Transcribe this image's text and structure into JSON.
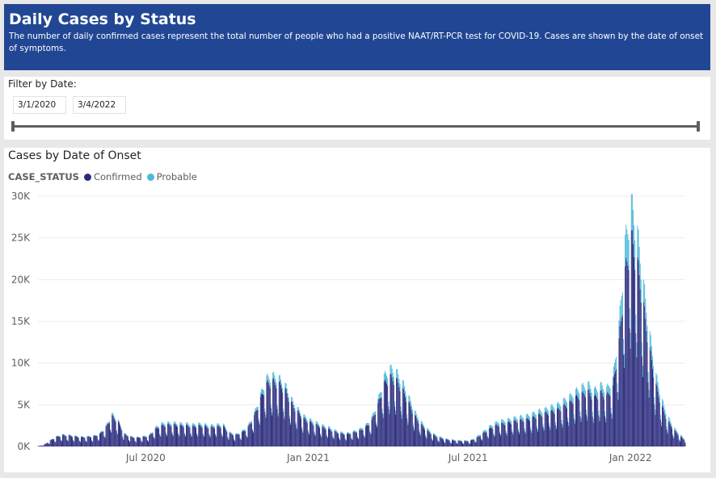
{
  "header": {
    "title": "Daily Cases by Status",
    "description": "The number of daily confirmed cases represent the total number of people who had a positive NAAT/RT-PCR test for COVID-19. Cases are shown by the date of onset of symptoms."
  },
  "filter": {
    "title": "Filter by Date:",
    "start_date": "3/1/2020",
    "end_date": "3/4/2022"
  },
  "chart_data": {
    "type": "bar",
    "title": "Cases by Date of Onset",
    "legend_title": "CASE_STATUS",
    "legend_position": "top-left",
    "grid": true,
    "stacked": true,
    "ylim": [
      0,
      30000
    ],
    "y_ticks": [
      "0K",
      "5K",
      "10K",
      "15K",
      "20K",
      "25K",
      "30K"
    ],
    "x_ticks": [
      "Jul 2020",
      "Jan 2021",
      "Jul 2021",
      "Jan 2022"
    ],
    "x_range": [
      "2020-03-01",
      "2022-03-04"
    ],
    "granularity": "daily (estimated weekly average values shown)",
    "series": [
      {
        "name": "Confirmed",
        "color": "#2a2a7c"
      },
      {
        "name": "Probable",
        "color": "#4fb9d8"
      }
    ],
    "points": [
      [
        "2020-03-01",
        50,
        0
      ],
      [
        "2020-03-08",
        200,
        10
      ],
      [
        "2020-03-15",
        700,
        30
      ],
      [
        "2020-03-22",
        1100,
        60
      ],
      [
        "2020-03-29",
        1300,
        80
      ],
      [
        "2020-04-05",
        1250,
        80
      ],
      [
        "2020-04-12",
        1150,
        80
      ],
      [
        "2020-04-19",
        1050,
        80
      ],
      [
        "2020-04-26",
        1100,
        80
      ],
      [
        "2020-05-03",
        1150,
        90
      ],
      [
        "2020-05-10",
        1400,
        100
      ],
      [
        "2020-05-17",
        2200,
        150
      ],
      [
        "2020-05-24",
        3500,
        250
      ],
      [
        "2020-05-31",
        2800,
        200
      ],
      [
        "2020-06-07",
        1400,
        100
      ],
      [
        "2020-06-14",
        1100,
        80
      ],
      [
        "2020-06-21",
        1000,
        70
      ],
      [
        "2020-06-28",
        1100,
        80
      ],
      [
        "2020-07-05",
        1200,
        90
      ],
      [
        "2020-07-12",
        2000,
        200
      ],
      [
        "2020-07-19",
        2400,
        250
      ],
      [
        "2020-07-26",
        2500,
        250
      ],
      [
        "2020-08-02",
        2500,
        250
      ],
      [
        "2020-08-09",
        2400,
        250
      ],
      [
        "2020-08-16",
        2400,
        250
      ],
      [
        "2020-08-23",
        2300,
        250
      ],
      [
        "2020-08-30",
        2400,
        250
      ],
      [
        "2020-09-06",
        2300,
        250
      ],
      [
        "2020-09-13",
        2200,
        250
      ],
      [
        "2020-09-20",
        2300,
        250
      ],
      [
        "2020-09-27",
        2300,
        250
      ],
      [
        "2020-10-04",
        1500,
        150
      ],
      [
        "2020-10-11",
        1300,
        120
      ],
      [
        "2020-10-18",
        1600,
        150
      ],
      [
        "2020-10-25",
        2200,
        200
      ],
      [
        "2020-11-01",
        3500,
        300
      ],
      [
        "2020-11-08",
        5500,
        500
      ],
      [
        "2020-11-15",
        7200,
        700
      ],
      [
        "2020-11-22",
        7500,
        700
      ],
      [
        "2020-11-29",
        7200,
        700
      ],
      [
        "2020-12-06",
        6500,
        600
      ],
      [
        "2020-12-13",
        5000,
        500
      ],
      [
        "2020-12-20",
        4000,
        400
      ],
      [
        "2020-12-27",
        3200,
        350
      ],
      [
        "2021-01-03",
        2800,
        300
      ],
      [
        "2021-01-10",
        2500,
        300
      ],
      [
        "2021-01-17",
        2200,
        250
      ],
      [
        "2021-01-24",
        2000,
        250
      ],
      [
        "2021-01-31",
        1700,
        200
      ],
      [
        "2021-02-07",
        1500,
        150
      ],
      [
        "2021-02-14",
        1400,
        150
      ],
      [
        "2021-02-21",
        1600,
        150
      ],
      [
        "2021-02-28",
        1800,
        200
      ],
      [
        "2021-03-07",
        2200,
        250
      ],
      [
        "2021-03-14",
        3000,
        300
      ],
      [
        "2021-03-21",
        4800,
        500
      ],
      [
        "2021-03-28",
        7200,
        900
      ],
      [
        "2021-04-04",
        8000,
        1000
      ],
      [
        "2021-04-11",
        7600,
        1000
      ],
      [
        "2021-04-18",
        6500,
        900
      ],
      [
        "2021-04-25",
        5000,
        700
      ],
      [
        "2021-05-02",
        3500,
        500
      ],
      [
        "2021-05-09",
        2500,
        350
      ],
      [
        "2021-05-16",
        1800,
        250
      ],
      [
        "2021-05-23",
        1300,
        180
      ],
      [
        "2021-05-30",
        1000,
        140
      ],
      [
        "2021-06-06",
        800,
        110
      ],
      [
        "2021-06-13",
        700,
        100
      ],
      [
        "2021-06-20",
        650,
        90
      ],
      [
        "2021-06-27",
        600,
        90
      ],
      [
        "2021-07-04",
        650,
        90
      ],
      [
        "2021-07-11",
        1000,
        150
      ],
      [
        "2021-07-18",
        1500,
        200
      ],
      [
        "2021-07-25",
        2000,
        300
      ],
      [
        "2021-08-01",
        2400,
        350
      ],
      [
        "2021-08-08",
        2600,
        400
      ],
      [
        "2021-08-15",
        2700,
        400
      ],
      [
        "2021-08-22",
        2900,
        400
      ],
      [
        "2021-08-29",
        3000,
        450
      ],
      [
        "2021-09-05",
        3100,
        450
      ],
      [
        "2021-09-12",
        3300,
        500
      ],
      [
        "2021-09-19",
        3600,
        500
      ],
      [
        "2021-09-26",
        3800,
        500
      ],
      [
        "2021-10-03",
        4000,
        600
      ],
      [
        "2021-10-10",
        4200,
        600
      ],
      [
        "2021-10-17",
        4600,
        700
      ],
      [
        "2021-10-24",
        5000,
        750
      ],
      [
        "2021-10-31",
        5600,
        800
      ],
      [
        "2021-11-07",
        6000,
        900
      ],
      [
        "2021-11-14",
        6300,
        900
      ],
      [
        "2021-11-21",
        5600,
        900
      ],
      [
        "2021-11-28",
        6200,
        900
      ],
      [
        "2021-12-05",
        5800,
        900
      ],
      [
        "2021-12-12",
        6800,
        1000
      ],
      [
        "2021-12-19",
        12000,
        2000
      ],
      [
        "2021-12-26",
        20000,
        3500
      ],
      [
        "2022-01-02",
        24000,
        4000
      ],
      [
        "2022-01-09",
        21000,
        3500
      ],
      [
        "2022-01-16",
        16000,
        2500
      ],
      [
        "2022-01-23",
        11000,
        1800
      ],
      [
        "2022-01-30",
        7000,
        1200
      ],
      [
        "2022-02-06",
        4500,
        800
      ],
      [
        "2022-02-13",
        2800,
        500
      ],
      [
        "2022-02-20",
        1800,
        300
      ],
      [
        "2022-02-27",
        1100,
        200
      ],
      [
        "2022-03-04",
        700,
        120
      ]
    ]
  }
}
